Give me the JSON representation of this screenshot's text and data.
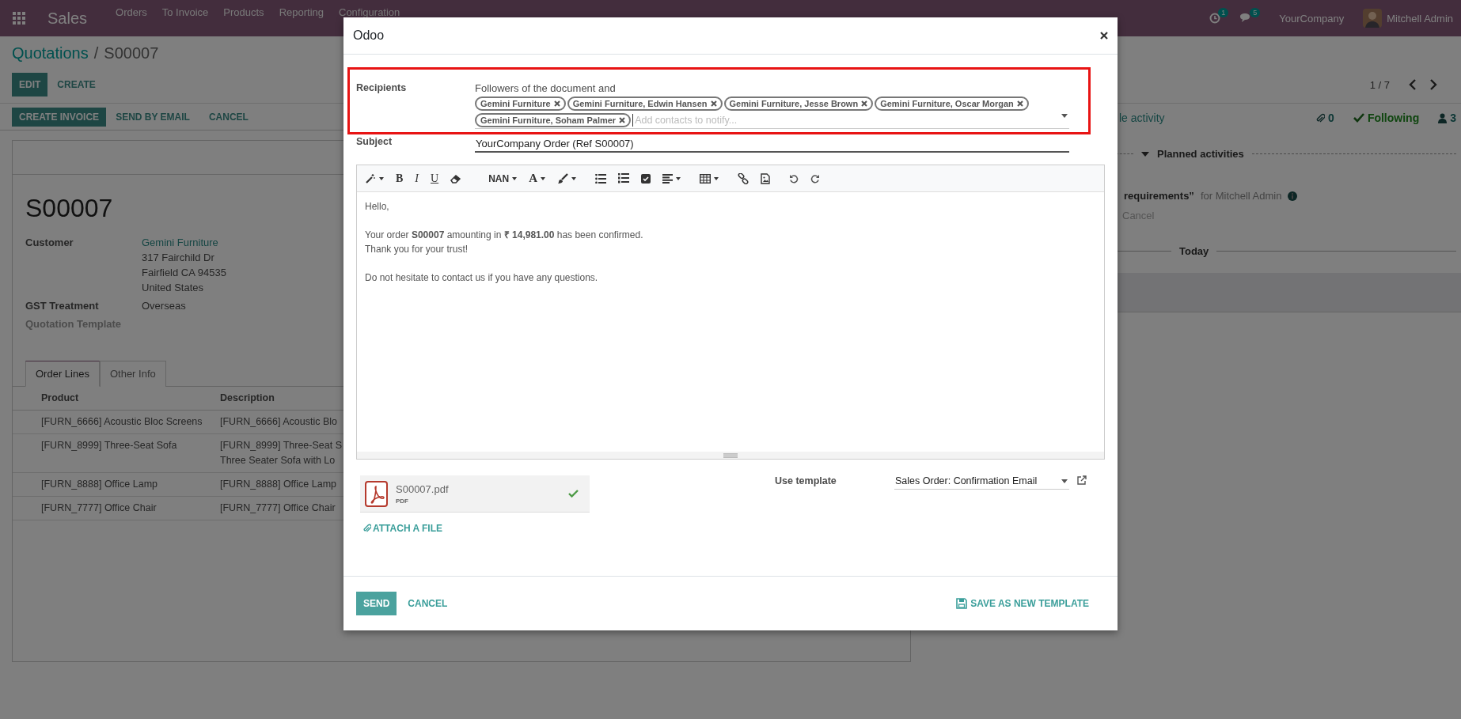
{
  "navbar": {
    "app": "Sales",
    "menu": [
      "Orders",
      "To Invoice",
      "Products",
      "Reporting",
      "Configuration"
    ],
    "activity_count": "1",
    "message_count": "5",
    "company": "YourCompany",
    "user": "Mitchell Admin"
  },
  "breadcrumb": {
    "parent": "Quotations",
    "separator": "/",
    "current": "S00007"
  },
  "control_buttons": [
    {
      "label": "EDIT",
      "primary": true
    },
    {
      "label": "CREATE",
      "primary": false
    }
  ],
  "pager": "1 / 7",
  "status_buttons": [
    {
      "label": "CREATE INVOICE",
      "primary": true
    },
    {
      "label": "SEND BY EMAIL",
      "primary": false
    },
    {
      "label": "CANCEL",
      "primary": false
    }
  ],
  "sheet": {
    "title": "S00007",
    "fields": [
      {
        "label": "Customer",
        "kind": "address",
        "lines": [
          "Gemini Furniture",
          "317 Fairchild Dr",
          "Fairfield CA 94535",
          "United States"
        ]
      },
      {
        "label": "GST Treatment",
        "kind": "text",
        "lines": [
          "Overseas"
        ]
      },
      {
        "label": "Quotation Template",
        "kind": "empty"
      }
    ],
    "tabs": [
      {
        "label": "Order Lines",
        "selected": true
      },
      {
        "label": "Other Info",
        "selected": false
      }
    ],
    "table": {
      "columns": [
        "Product",
        "Description"
      ],
      "rows": [
        {
          "product": "[FURN_6666] Acoustic Bloc Screens",
          "description": [
            "[FURN_6666] Acoustic Blo"
          ]
        },
        {
          "product": "[FURN_8999] Three-Seat Sofa",
          "description": [
            "[FURN_8999] Three-Seat S",
            "Three Seater Sofa with Lo"
          ]
        },
        {
          "product": "[FURN_8888] Office Lamp",
          "description": [
            "[FURN_8888] Office Lamp"
          ]
        },
        {
          "product": "[FURN_7777] Office Chair",
          "description": [
            "[FURN_7777] Office Chair"
          ]
        }
      ]
    }
  },
  "chatter": {
    "activity_link": "le activity",
    "attachments": "0",
    "follow": "Following",
    "followers": "3",
    "planned": "Planned activities",
    "activity_title": "requirements”",
    "activity_assignee": "for Mitchell Admin",
    "cancel": "Cancel",
    "today": "Today"
  },
  "dialog": {
    "title": "Odoo",
    "recipients": {
      "label": "Recipients",
      "intro": "Followers of the document and",
      "tags": [
        "Gemini Furniture",
        "Gemini Furniture, Edwin Hansen",
        "Gemini Furniture, Jesse Brown",
        "Gemini Furniture, Oscar Morgan",
        "Gemini Furniture, Soham Palmer"
      ],
      "placeholder": "Add contacts to notify..."
    },
    "subject": {
      "label": "Subject",
      "value": "YourCompany Order (Ref S00007)"
    },
    "toolbar": [
      {
        "kind": "wand",
        "dropdown": true
      },
      {
        "kind": "letter",
        "label": "B",
        "dropdown": false
      },
      {
        "kind": "letter",
        "label": "I",
        "dropdown": false
      },
      {
        "kind": "letter",
        "label": "U",
        "dropdown": false
      },
      {
        "kind": "eraser",
        "dropdown": false
      },
      {
        "kind": "letter",
        "label": "NAN",
        "dropdown": true
      },
      {
        "kind": "letter",
        "label": "A",
        "dropdown": true
      },
      {
        "kind": "brush",
        "dropdown": true
      },
      {
        "kind": "bullets",
        "dropdown": false
      },
      {
        "kind": "numbers",
        "dropdown": false
      },
      {
        "kind": "checkbox",
        "dropdown": false
      },
      {
        "kind": "align",
        "dropdown": true
      },
      {
        "kind": "table",
        "dropdown": true
      },
      {
        "kind": "link",
        "dropdown": false
      },
      {
        "kind": "image",
        "dropdown": false
      },
      {
        "kind": "undo",
        "dropdown": false
      },
      {
        "kind": "redo",
        "dropdown": false
      }
    ],
    "body": [
      [
        "Hello,"
      ],
      [
        "Your order **S00007** amounting in **₹ 14,981.00** has been confirmed.",
        "Thank you for your trust!"
      ],
      [
        "Do not hesitate to contact us if you have any questions."
      ]
    ],
    "attachment": {
      "name": "S00007.pdf",
      "type": "PDF",
      "uploaded": true
    },
    "attach_link": "ATTACH A FILE",
    "template": {
      "label": "Use template",
      "value": "Sales Order: Confirmation Email"
    },
    "buttons": [
      {
        "label": "SEND",
        "primary": true
      },
      {
        "label": "CANCEL",
        "primary": false
      }
    ],
    "save_template": "SAVE AS NEW TEMPLATE"
  }
}
